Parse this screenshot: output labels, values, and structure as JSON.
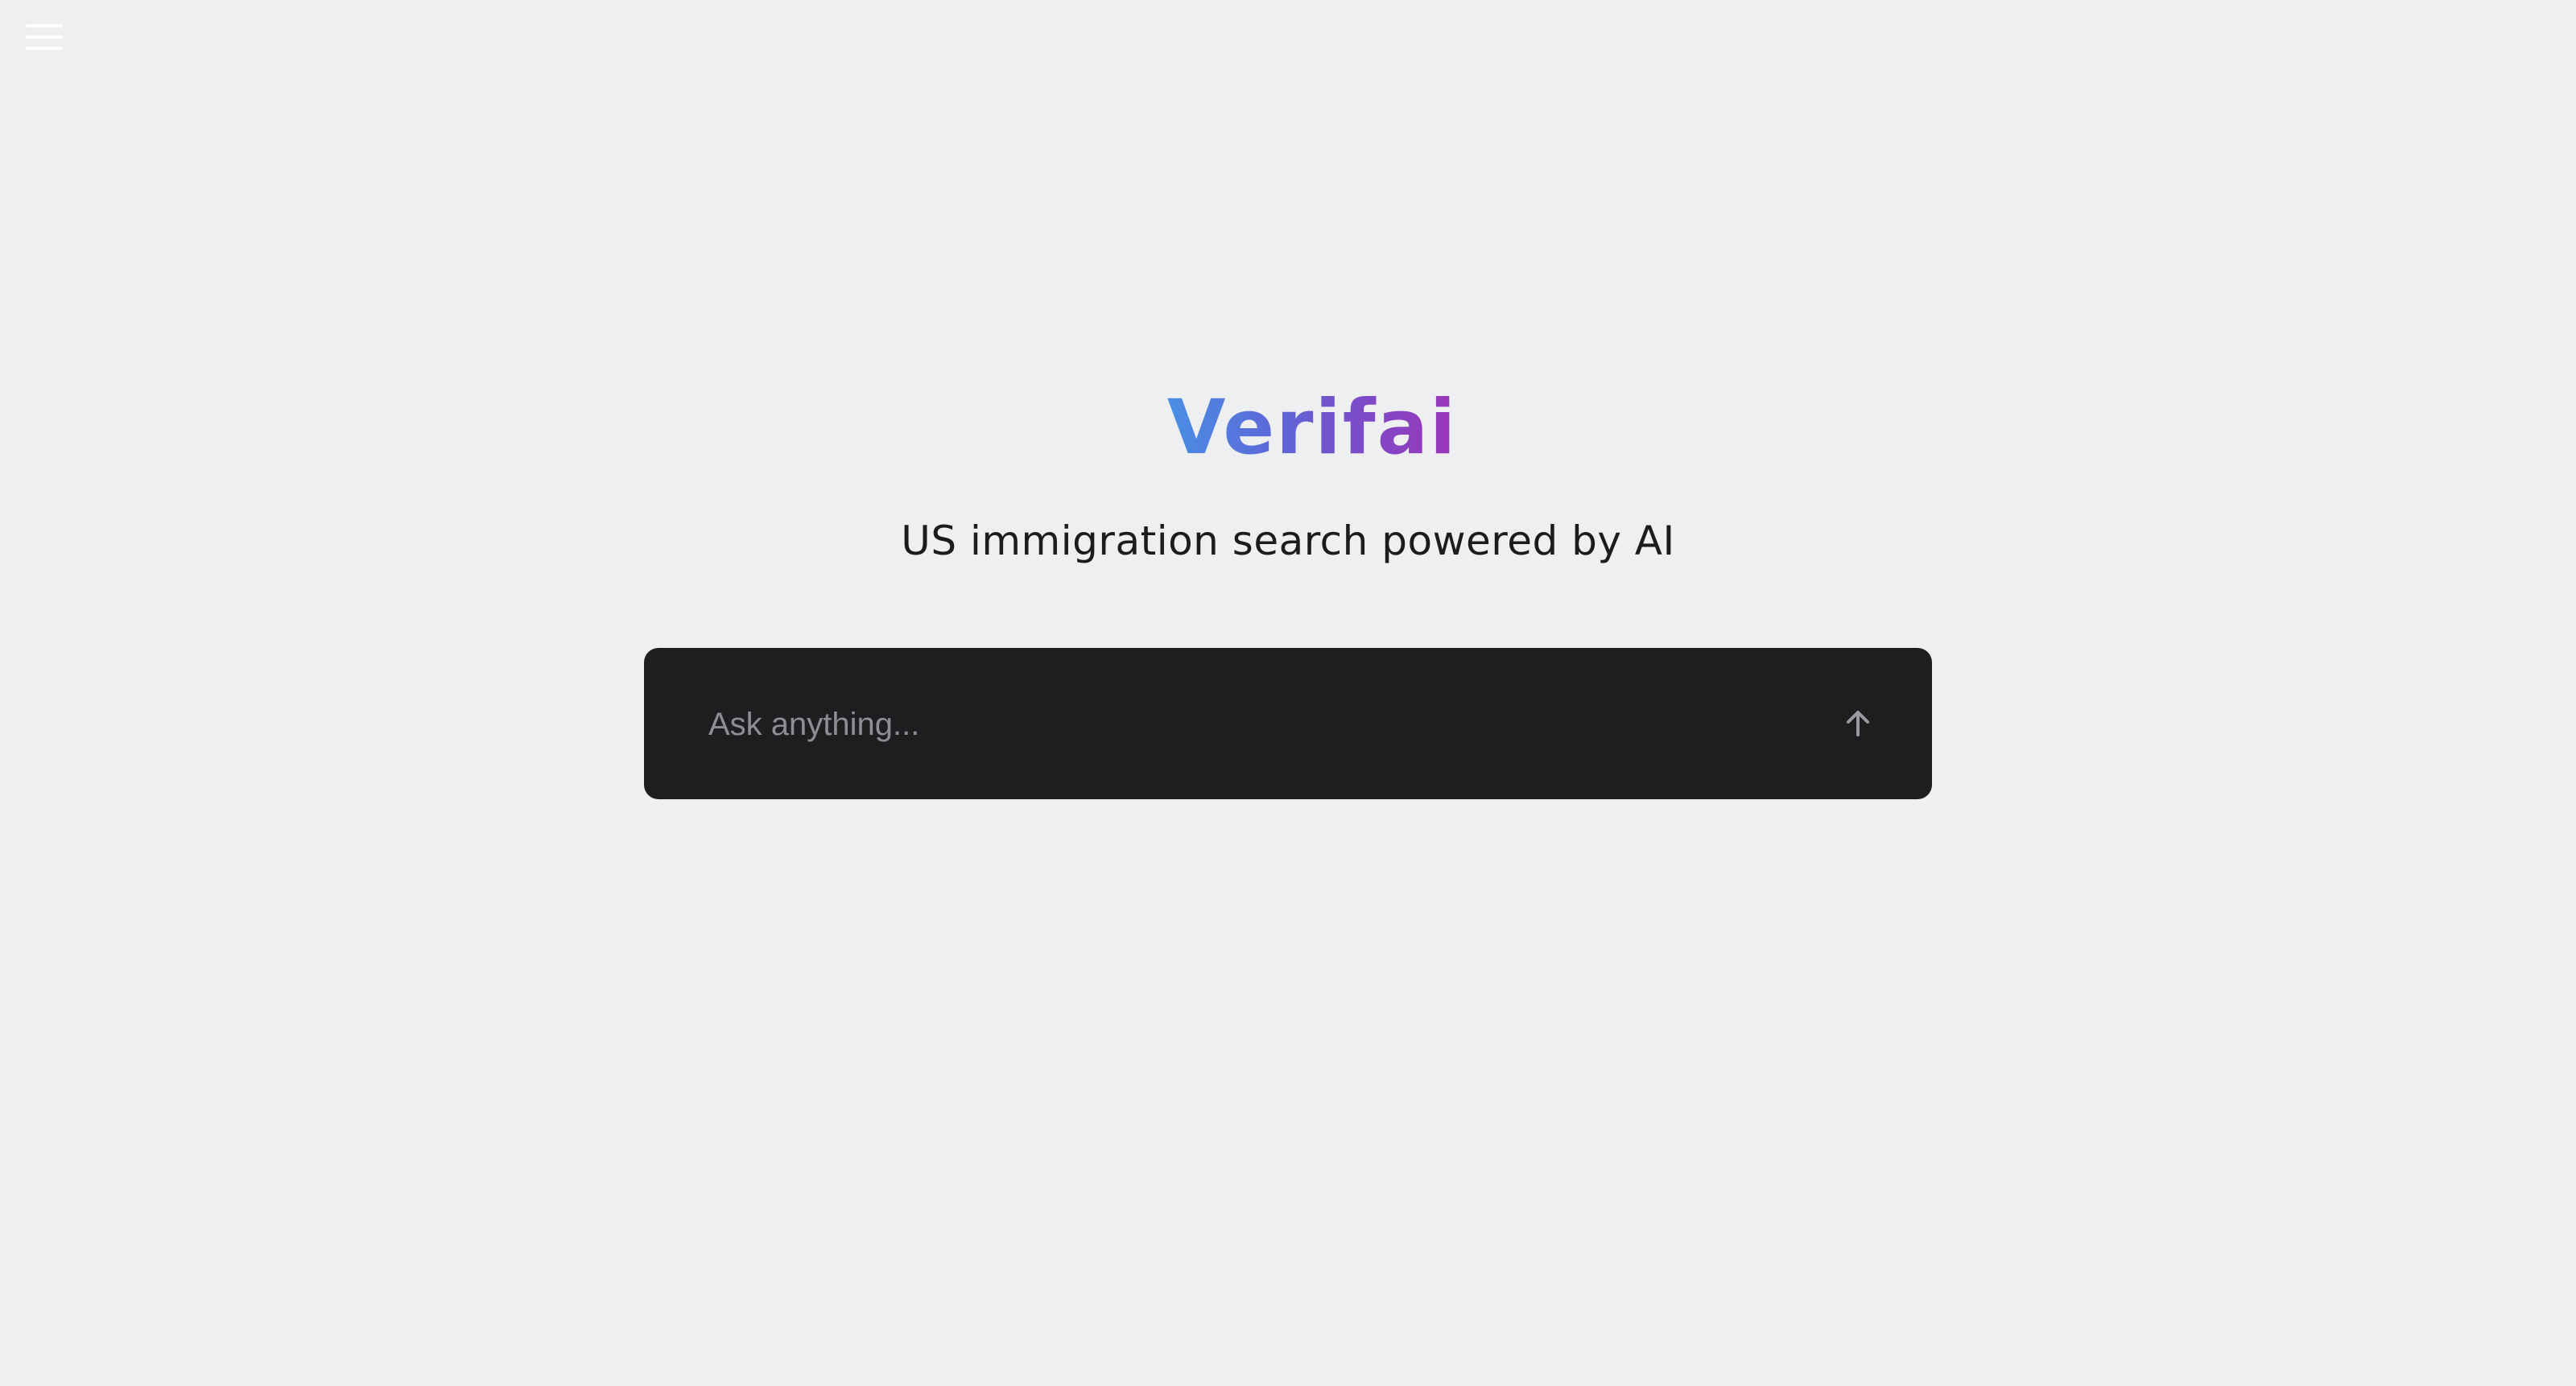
{
  "header": {
    "menu_icon": "hamburger-menu-icon"
  },
  "hero": {
    "brand": "Verifai",
    "tagline": "US immigration search powered by AI"
  },
  "search": {
    "placeholder": "Ask anything...",
    "value": "",
    "submit_icon": "arrow-up-icon"
  },
  "colors": {
    "background": "#eeeff1",
    "search_box": "#1e1e21",
    "brand_gradient_start": "#4a90e6",
    "brand_gradient_end": "#9b36b8",
    "tagline": "#1c1c1f",
    "placeholder": "#8d8d93"
  }
}
